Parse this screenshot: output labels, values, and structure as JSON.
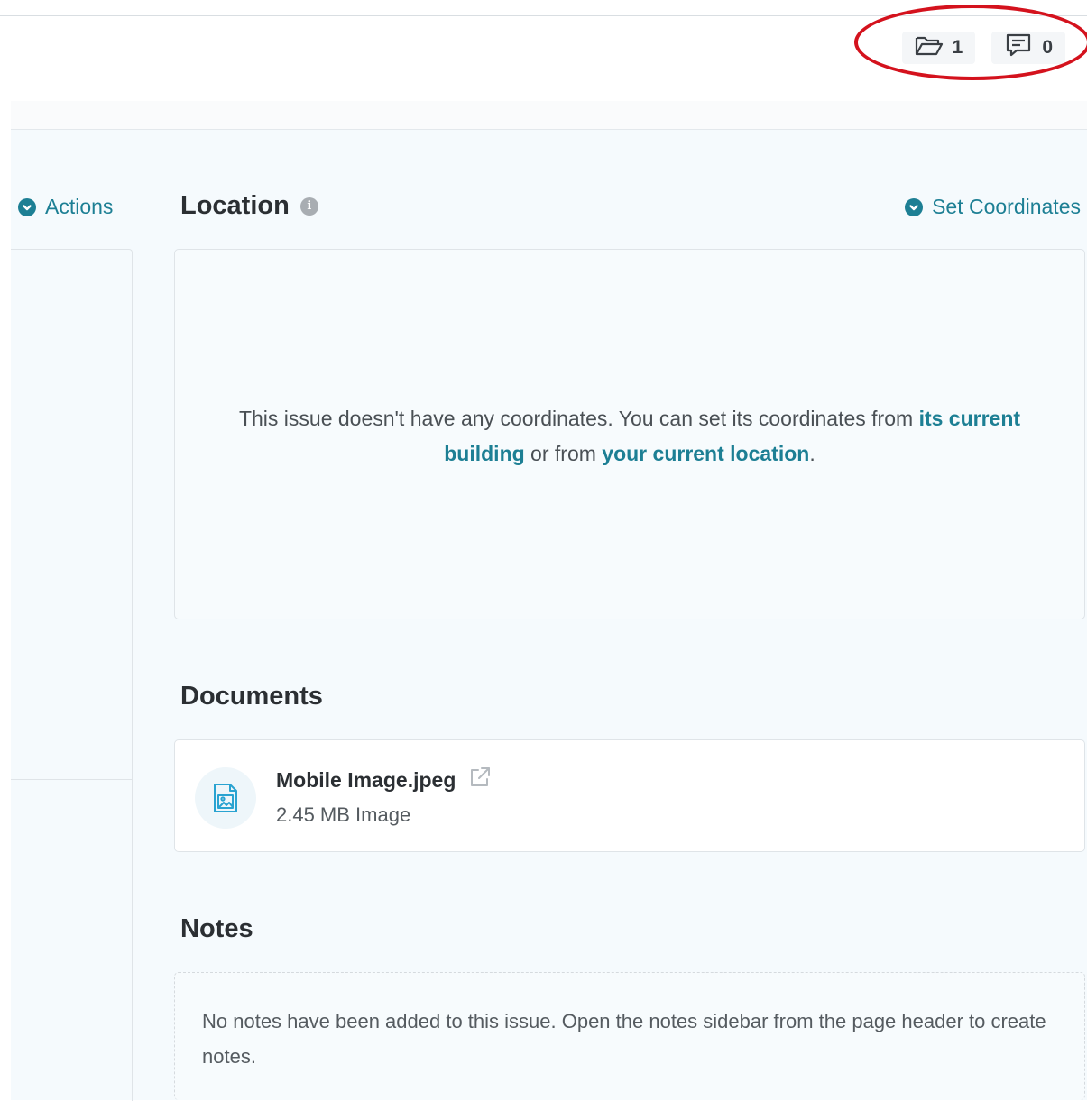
{
  "header": {
    "documents_count": "1",
    "notes_count": "0"
  },
  "left": {
    "actions_label": "Actions"
  },
  "location": {
    "title": "Location",
    "set_coordinates_label": "Set Coordinates",
    "message_start": "This issue doesn't have any coordinates. You can set its coordinates from ",
    "link_building": "its current building",
    "message_middle": " or from ",
    "link_location": "your current location",
    "message_end": "."
  },
  "documents": {
    "title": "Documents",
    "items": [
      {
        "name": "Mobile Image.jpeg",
        "meta": "2.45 MB Image"
      }
    ]
  },
  "notes": {
    "title": "Notes",
    "empty_message": "No notes have been added to this issue. Open the notes sidebar from the page header to create notes."
  },
  "colors": {
    "accent": "#1d7f94",
    "highlight": "#d4121d"
  }
}
